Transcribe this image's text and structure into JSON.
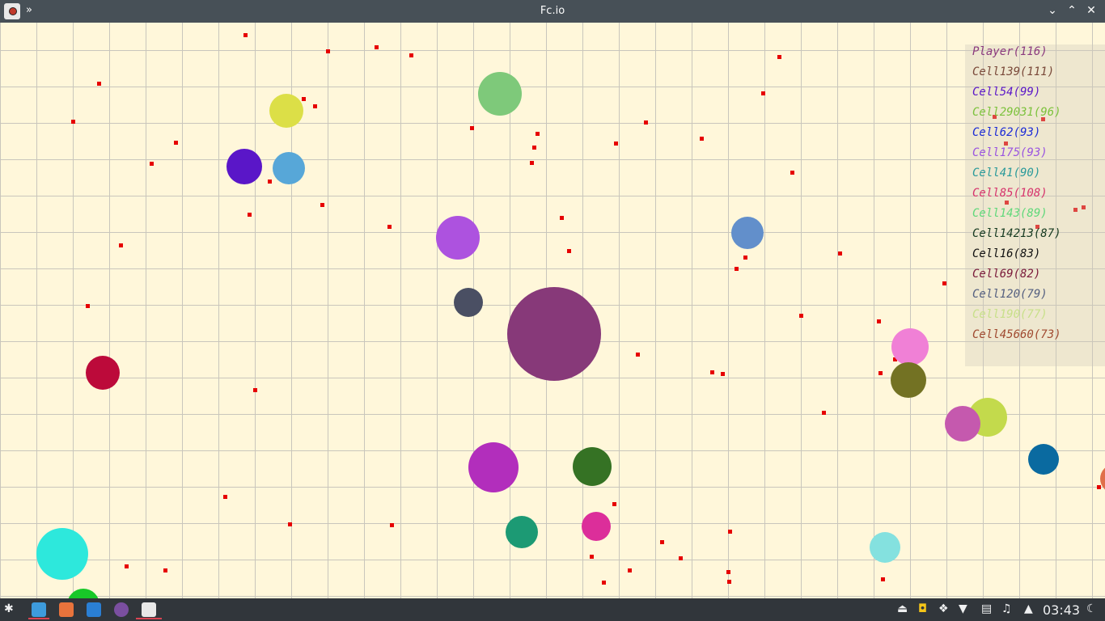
{
  "window": {
    "title": "Fc.io",
    "menu_glyph": "»",
    "minimize_glyph": "⌄",
    "maximize_glyph": "⌃",
    "close_glyph": "✕",
    "app_icon": "fcio-app-icon"
  },
  "leaderboard": [
    {
      "text": "Player(116)",
      "color": "#8b3a7e"
    },
    {
      "text": "Cell139(111)",
      "color": "#7a4a3a"
    },
    {
      "text": "Cell54(99)",
      "color": "#5a16c8"
    },
    {
      "text": "Cell29031(96)",
      "color": "#7cc23c"
    },
    {
      "text": "Cell62(93)",
      "color": "#1c2bd6"
    },
    {
      "text": "Cell175(93)",
      "color": "#9a55e0"
    },
    {
      "text": "Cell41(90)",
      "color": "#2a9a9a"
    },
    {
      "text": "Cell85(108)",
      "color": "#d6336c"
    },
    {
      "text": "Cell143(89)",
      "color": "#5fd87a"
    },
    {
      "text": "Cell14213(87)",
      "color": "#163a20"
    },
    {
      "text": "Cell16(83)",
      "color": "#111111"
    },
    {
      "text": "Cell69(82)",
      "color": "#7a1a3a"
    },
    {
      "text": "Cell120(79)",
      "color": "#556080"
    },
    {
      "text": "Cell190(77)",
      "color": "#c8e08a"
    },
    {
      "text": "Cell45660(73)",
      "color": "#a04a30"
    }
  ],
  "taskbar": {
    "clock": "03:43",
    "apps": [
      "kde-launcher-icon",
      "file-manager-icon",
      "brave-browser-icon",
      "writer-icon",
      "tor-browser-icon",
      "fcio-app-icon"
    ],
    "tray": [
      "eject-icon",
      "ghost-icon",
      "dropbox-icon",
      "wifi-icon",
      "clipboard-icon",
      "volume-icon",
      "tray-expand-icon",
      "night-mode-icon"
    ]
  },
  "colors": {
    "board_bg": "#fff7da",
    "grid_line": "#c9c6bc",
    "food": "#e60000",
    "titlebar": "#475057",
    "taskbar": "#31363b",
    "active_task_underline": "#da4453"
  }
}
